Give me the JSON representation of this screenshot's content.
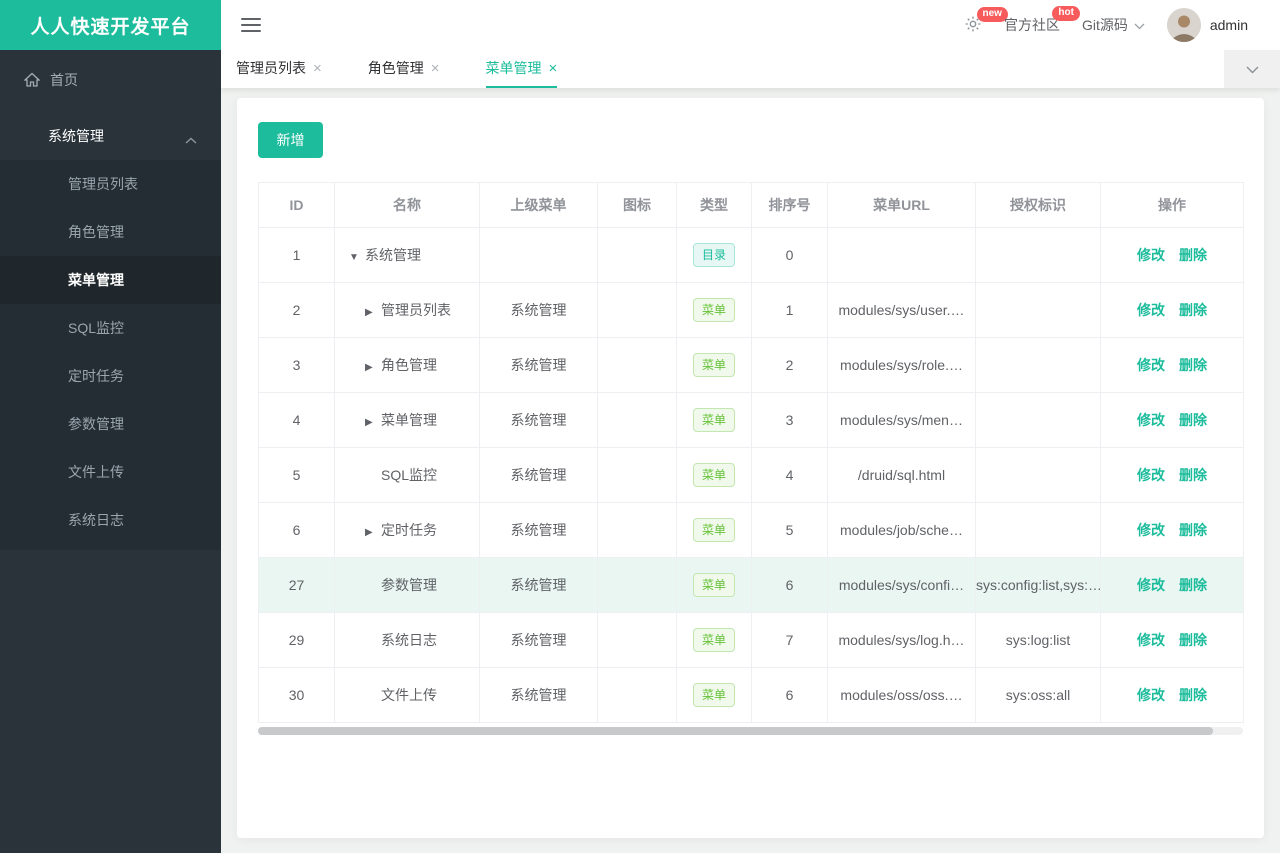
{
  "app": {
    "title": "人人快速开发平台"
  },
  "header": {
    "notice_badge": "new",
    "community_label": "官方社区",
    "community_badge": "hot",
    "git_label": "Git源码",
    "username": "admin"
  },
  "tabbar": {
    "close_glyph": "×",
    "tabs": [
      {
        "label": "管理员列表"
      },
      {
        "label": "角色管理"
      },
      {
        "label": "菜单管理"
      }
    ]
  },
  "sidebar": {
    "home_label": "首页",
    "group_label": "系统管理",
    "items": [
      {
        "label": "管理员列表"
      },
      {
        "label": "角色管理"
      },
      {
        "label": "菜单管理"
      },
      {
        "label": "SQL监控"
      },
      {
        "label": "定时任务"
      },
      {
        "label": "参数管理"
      },
      {
        "label": "文件上传"
      },
      {
        "label": "系统日志"
      }
    ]
  },
  "toolbar": {
    "add_label": "新增"
  },
  "table": {
    "headers": [
      "ID",
      "名称",
      "上级菜单",
      "图标",
      "类型",
      "排序号",
      "菜单URL",
      "授权标识",
      "操作"
    ],
    "actions": {
      "edit": "修改",
      "delete": "删除"
    },
    "rows": [
      {
        "id": "1",
        "expand": "▼",
        "name": "系统管理",
        "parent": "",
        "icon": "",
        "type": "目录",
        "order": "0",
        "url": "",
        "perms": ""
      },
      {
        "id": "2",
        "expand": "▶",
        "name": "管理员列表",
        "parent": "系统管理",
        "icon": "",
        "type": "菜单",
        "order": "1",
        "url": "modules/sys/user.…",
        "perms": ""
      },
      {
        "id": "3",
        "expand": "▶",
        "name": "角色管理",
        "parent": "系统管理",
        "icon": "",
        "type": "菜单",
        "order": "2",
        "url": "modules/sys/role.…",
        "perms": ""
      },
      {
        "id": "4",
        "expand": "▶",
        "name": "菜单管理",
        "parent": "系统管理",
        "icon": "",
        "type": "菜单",
        "order": "3",
        "url": "modules/sys/men…",
        "perms": ""
      },
      {
        "id": "5",
        "expand": "",
        "name": "SQL监控",
        "parent": "系统管理",
        "icon": "",
        "type": "菜单",
        "order": "4",
        "url": "/druid/sql.html",
        "perms": ""
      },
      {
        "id": "6",
        "expand": "▶",
        "name": "定时任务",
        "parent": "系统管理",
        "icon": "",
        "type": "菜单",
        "order": "5",
        "url": "modules/job/sche…",
        "perms": ""
      },
      {
        "id": "27",
        "expand": "",
        "name": "参数管理",
        "parent": "系统管理",
        "icon": "",
        "type": "菜单",
        "order": "6",
        "url": "modules/sys/confi…",
        "perms": "sys:config:list,sys:…"
      },
      {
        "id": "29",
        "expand": "",
        "name": "系统日志",
        "parent": "系统管理",
        "icon": "",
        "type": "菜单",
        "order": "7",
        "url": "modules/sys/log.h…",
        "perms": "sys:log:list"
      },
      {
        "id": "30",
        "expand": "",
        "name": "文件上传",
        "parent": "系统管理",
        "icon": "",
        "type": "菜单",
        "order": "6",
        "url": "modules/oss/oss.…",
        "perms": "sys:oss:all"
      }
    ]
  },
  "colors": {
    "accent": "#1cbc9c",
    "sidebar_bg": "#2a333a",
    "badge_red": "#f85b5b",
    "menu_tag_green": "#67c23a",
    "highlight_row": "#e9f6f2"
  }
}
